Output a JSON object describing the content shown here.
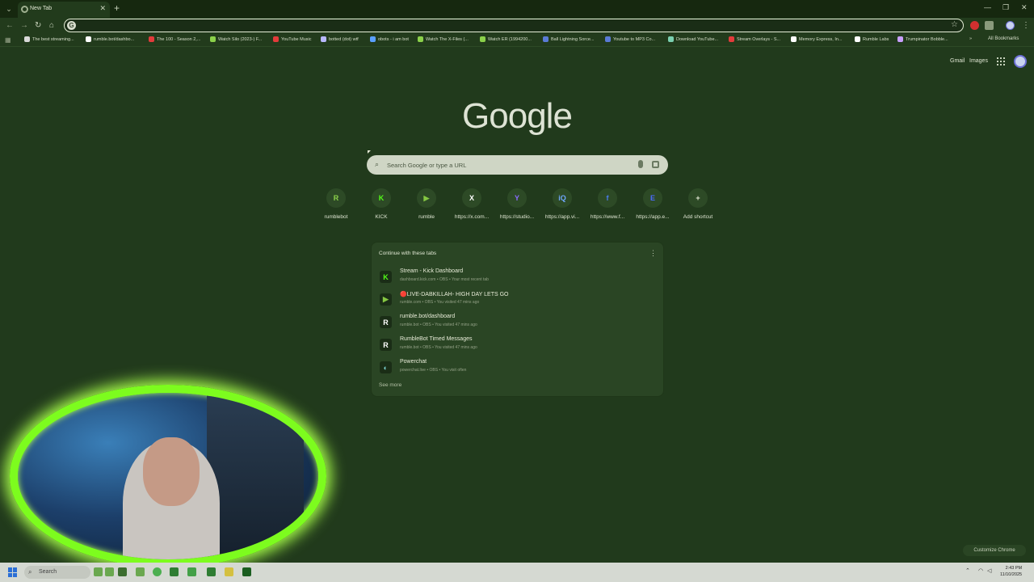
{
  "browser": {
    "tab_title": "New Tab",
    "omnibox_value": "",
    "bookmarks": [
      {
        "label": "The best streaming...",
        "color": "#d9d9d9"
      },
      {
        "label": "rumble.bot/dashbo...",
        "color": "#ffffff"
      },
      {
        "label": "The 100 - Season 2,...",
        "color": "#e33b3b"
      },
      {
        "label": "Watch Silo (2023-) F...",
        "color": "#8bd14a"
      },
      {
        "label": "YouTube Music",
        "color": "#e33b3b"
      },
      {
        "label": "botted (dot) wtf",
        "color": "#b8b8ff"
      },
      {
        "label": "obots - i am bot",
        "color": "#5aa0ff"
      },
      {
        "label": "Watch The X-Files (...",
        "color": "#8bd14a"
      },
      {
        "label": "Watch ER (1994200...",
        "color": "#8bd14a"
      },
      {
        "label": "Ball Lightning Sorce...",
        "color": "#5a7bd6"
      },
      {
        "label": "Youtube to MP3 Co...",
        "color": "#5a7bd6"
      },
      {
        "label": "Download YouTube...",
        "color": "#7ad0b0"
      },
      {
        "label": "Stream Overlays - S...",
        "color": "#e33b3b"
      },
      {
        "label": "Memory Express, In...",
        "color": "#ffffff"
      },
      {
        "label": "Rumble Labs",
        "color": "#ffffff"
      },
      {
        "label": "Trumpinator Bobble...",
        "color": "#c9a0ff"
      }
    ],
    "all_bookmarks": "All Bookmarks"
  },
  "header": {
    "gmail": "Gmail",
    "images": "Images"
  },
  "google": {
    "logo": "Google",
    "search_placeholder": "Search Google or type a URL"
  },
  "shortcuts": [
    {
      "label": "rumblebot",
      "glyph": "R",
      "color": "#8bd14a"
    },
    {
      "label": "KICK",
      "glyph": "K",
      "color": "#53fc18"
    },
    {
      "label": "rumble",
      "glyph": "▶",
      "color": "#85c742"
    },
    {
      "label": "https://x.com...",
      "glyph": "X",
      "color": "#ffffff"
    },
    {
      "label": "https://studio...",
      "glyph": "Y",
      "color": "#8a6bff"
    },
    {
      "label": "https://app.vi...",
      "glyph": "iQ",
      "color": "#6fa8ff"
    },
    {
      "label": "https://www.f...",
      "glyph": "f",
      "color": "#4a7df0"
    },
    {
      "label": "https://app.e...",
      "glyph": "E",
      "color": "#4a6bff"
    },
    {
      "label": "Add shortcut",
      "glyph": "+",
      "color": "#e8ecd8"
    }
  ],
  "continue": {
    "title": "Continue with these tabs",
    "items": [
      {
        "title": "Stream - Kick Dashboard",
        "sub": "dashboard.kick.com • OBS • Your most recent tab",
        "glyph": "K",
        "color": "#53fc18"
      },
      {
        "title": "🔴LIVE-DABKILLAH- HIGH DAY LETS GO",
        "sub": "rumble.com • OBS • You visited 47 mins ago",
        "glyph": "▶",
        "color": "#85c742"
      },
      {
        "title": "rumble.bot/dashboard",
        "sub": "rumble.bot • OBS • You visited 47 mins ago",
        "glyph": "R",
        "color": "#ffffff"
      },
      {
        "title": "RumbleBot Timed Messages",
        "sub": "rumble.bot • OBS • You visited 47 mins ago",
        "glyph": "R",
        "color": "#ffffff"
      },
      {
        "title": "Powerchat",
        "sub": "powerchat.live • OBS • You visit often",
        "glyph": "◐",
        "color": "#7ad0d0"
      }
    ],
    "see_more": "See more"
  },
  "customize": "Customize Chrome",
  "taskbar": {
    "search": "Search",
    "time": "2:43 PM",
    "date": "11/10/2025"
  }
}
